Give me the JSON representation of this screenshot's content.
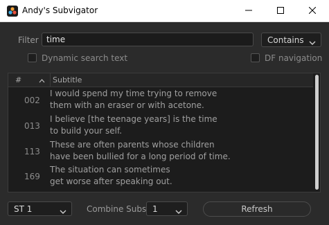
{
  "window": {
    "title": "Andy's Subvigator",
    "icons": {
      "app": "davinci-resolve-logo-icon",
      "minimize": "minimize-icon",
      "maximize": "maximize-icon",
      "close": "close-icon"
    }
  },
  "filter": {
    "label": "Filter",
    "value": "time",
    "mode_selected": "Contains"
  },
  "options": {
    "dynamic_search_label": "Dynamic search text",
    "dynamic_search_checked": false,
    "df_navigation_label": "DF navigation",
    "df_navigation_checked": false
  },
  "table": {
    "columns": {
      "number": "#",
      "subtitle": "Subtitle"
    },
    "rows": [
      {
        "num": "002",
        "line1": "I would spend my time trying to remove",
        "line2": "them with an eraser or with acetone."
      },
      {
        "num": "013",
        "line1": "I believe [the teenage years] is the time",
        "line2": "to build your self."
      },
      {
        "num": "113",
        "line1": "These are often parents whose children",
        "line2": "have been bullied for a long period of time."
      },
      {
        "num": "169",
        "line1": "The situation can sometimes",
        "line2": "get worse after speaking out."
      }
    ]
  },
  "bottom": {
    "track_selected": "ST 1",
    "combine_label": "Combine Subs",
    "combine_value": "1",
    "refresh_label": "Refresh"
  },
  "colors": {
    "background": "#2b2b2b",
    "titlebar": "#ffffff",
    "table_bg": "#1c1c1c",
    "text": "#c8c8c8",
    "muted_text": "#8c8c8c"
  }
}
